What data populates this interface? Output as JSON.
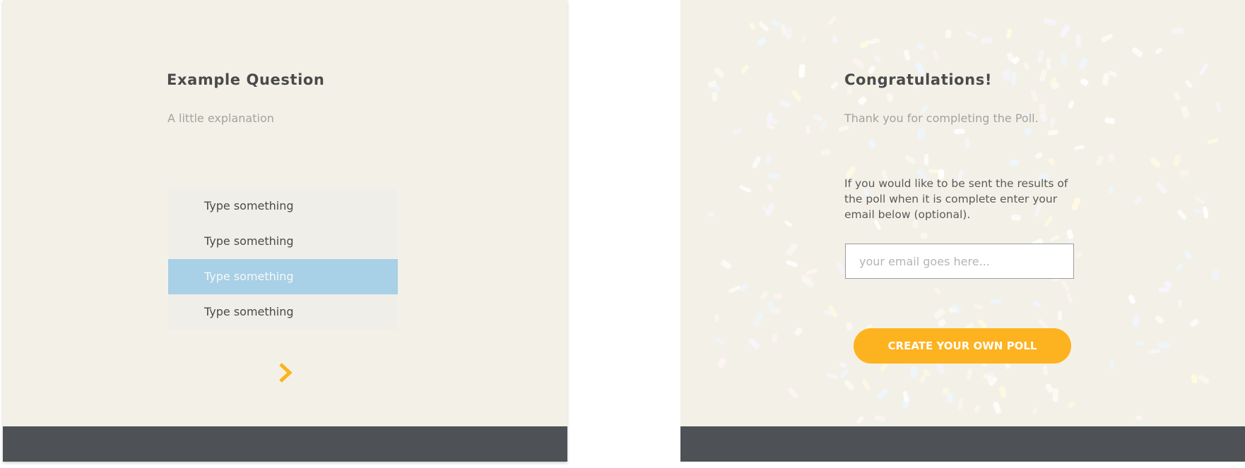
{
  "question_screen": {
    "title": "Example Question",
    "subtitle": "A little explanation",
    "options": [
      "Type something",
      "Type something",
      "Type something",
      "Type something"
    ],
    "selected_index": 2,
    "next_icon": "chevron-right-icon"
  },
  "thanks_screen": {
    "title": "Congratulations!",
    "subtitle": "Thank you for completing the Poll.",
    "body": "If you would like to be sent the results of the poll when it is complete enter your email below (optional).",
    "email_placeholder": "your email goes here...",
    "email_value": "",
    "cta_label": "CREATE YOUR OWN POLL"
  },
  "colors": {
    "panel_bg": "#f3f1e7",
    "footer": "#4e5256",
    "accent": "#fdb21f",
    "selected_option": "#a8d0e6",
    "option_bg": "#f0eee9"
  }
}
